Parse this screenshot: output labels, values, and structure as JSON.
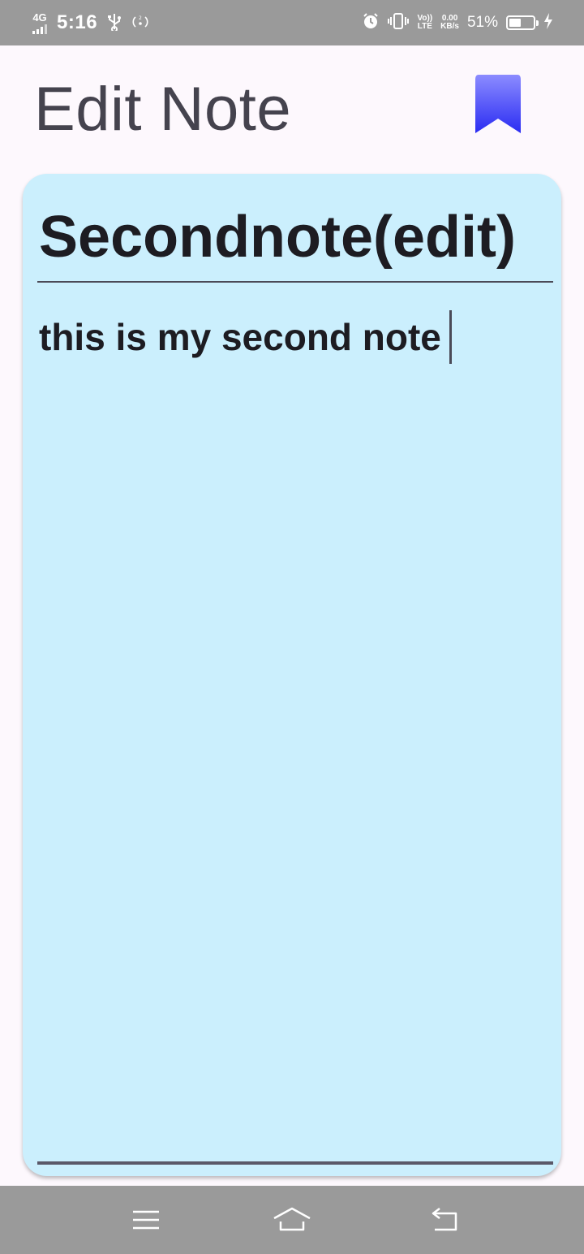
{
  "status_bar": {
    "network": "4G",
    "time": "5:16",
    "volte_top": "Vo))",
    "volte_bottom": "LTE",
    "speed_value": "0.00",
    "speed_unit": "KB/s",
    "battery_percent": "51%",
    "battery_level": 0.51,
    "icons": [
      "usb-icon",
      "hotspot-icon",
      "alarm-icon",
      "vibrate-icon",
      "charging-bolt-icon"
    ]
  },
  "header": {
    "title": "Edit Note",
    "bookmark_icon": "bookmark-icon",
    "accent_color": "#3a3cf5"
  },
  "note": {
    "title": "Secondnote(edit)",
    "body": "this is my second note",
    "background": "#cbeffd"
  },
  "nav_bar": {
    "icons": [
      "menu-icon",
      "home-icon",
      "back-icon"
    ]
  }
}
